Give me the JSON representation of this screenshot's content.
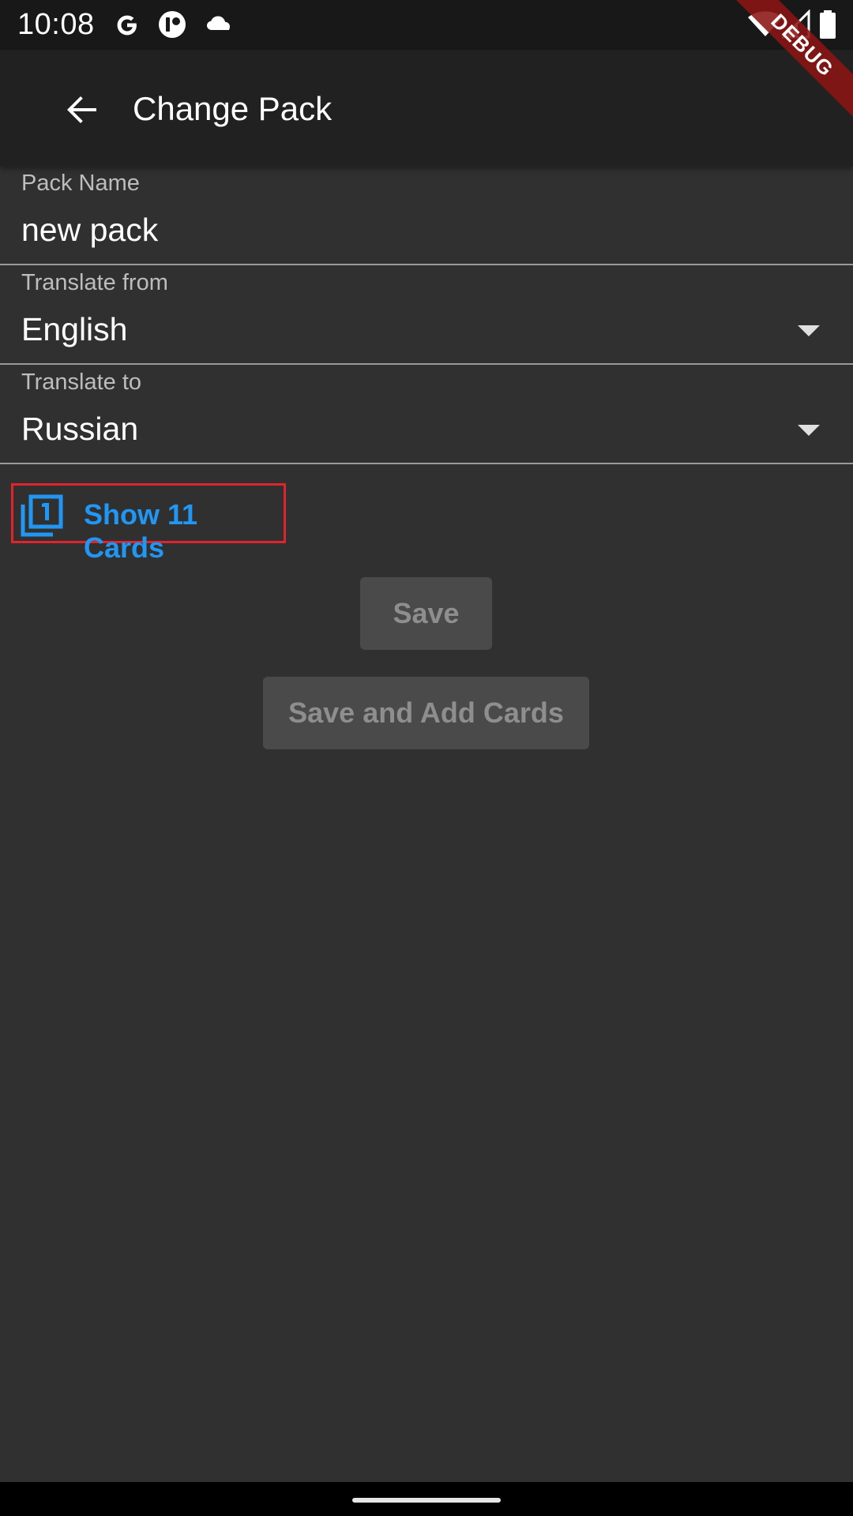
{
  "status_bar": {
    "time": "10:08",
    "left_icons": [
      "google-icon",
      "app-notification-icon",
      "cloud-icon"
    ],
    "right_icons": [
      "wifi-icon",
      "signal-icon",
      "battery-icon"
    ]
  },
  "debug_banner": "DEBUG",
  "app_bar": {
    "title": "Change Pack",
    "back_icon": "arrow-back-icon"
  },
  "form": {
    "pack_name": {
      "label": "Pack Name",
      "value": "new pack"
    },
    "translate_from": {
      "label": "Translate from",
      "value": "English"
    },
    "translate_to": {
      "label": "Translate to",
      "value": "Russian"
    }
  },
  "show_cards": {
    "label": "Show 11 Cards",
    "icon": "filter-1-icon",
    "color": "#2196f3"
  },
  "buttons": {
    "save": "Save",
    "save_and_add": "Save and Add Cards"
  },
  "colors": {
    "background": "#303030",
    "app_bar": "#212121",
    "accent": "#2196f3",
    "highlight_border": "#e0242d",
    "debug_ribbon": "#8c1414"
  }
}
